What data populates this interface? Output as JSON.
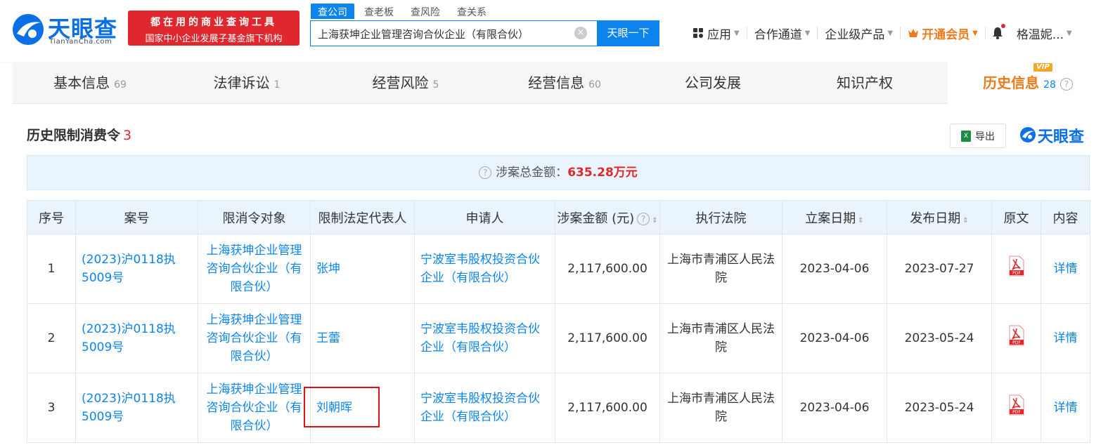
{
  "header": {
    "logo_text": "天眼查",
    "logo_sub": "TianYanCha.com",
    "slogan_line1": "都在用的商业查询工具",
    "slogan_line2": "国家中小企业发展子基金旗下机构",
    "search_tabs": [
      "查公司",
      "查老板",
      "查风险",
      "查关系"
    ],
    "search_value": "上海获坤企业管理咨询合伙企业（有限合伙）",
    "search_button": "天眼一下",
    "nav": {
      "apps": "应用",
      "partner": "合作通道",
      "enterprise": "企业级产品",
      "vip": "开通会员",
      "user": "格温妮..."
    }
  },
  "tabs": [
    {
      "label": "基本信息",
      "count": "69"
    },
    {
      "label": "法律诉讼",
      "count": "1"
    },
    {
      "label": "经营风险",
      "count": "5"
    },
    {
      "label": "经营信息",
      "count": "60"
    },
    {
      "label": "公司发展",
      "count": ""
    },
    {
      "label": "知识产权",
      "count": ""
    },
    {
      "label": "历史信息",
      "count": "28",
      "badge": "VIP"
    }
  ],
  "section": {
    "title": "历史限制消费令",
    "count": "3",
    "export_label": "导出",
    "watermark": "天眼查",
    "summary_label": "涉案总金额：",
    "summary_amount": "635.28万元"
  },
  "table": {
    "headers": [
      "序号",
      "案号",
      "限消令对象",
      "限制法定代表人",
      "申请人",
      "涉案金额 (元)",
      "执行法院",
      "立案日期",
      "发布日期",
      "原文",
      "内容"
    ],
    "rows": [
      {
        "no": "1",
        "case": "(2023)沪0118执5009号",
        "target": "上海获坤企业管理咨询合伙企业（有限合伙）",
        "person": "张坤",
        "applicant": "宁波室韦股权投资合伙企业（有限合伙）",
        "amount": "2,117,600.00",
        "court": "上海市青浦区人民法院",
        "filed": "2023-04-06",
        "published": "2023-07-27",
        "detail": "详情"
      },
      {
        "no": "2",
        "case": "(2023)沪0118执5009号",
        "target": "上海获坤企业管理咨询合伙企业（有限合伙）",
        "person": "王蕾",
        "applicant": "宁波室韦股权投资合伙企业（有限合伙）",
        "amount": "2,117,600.00",
        "court": "上海市青浦区人民法院",
        "filed": "2023-04-06",
        "published": "2023-05-24",
        "detail": "详情"
      },
      {
        "no": "3",
        "case": "(2023)沪0118执5009号",
        "target": "上海获坤企业管理咨询合伙企业（有限合伙）",
        "person": "刘朝晖",
        "applicant": "宁波室韦股权投资合伙企业（有限合伙）",
        "amount": "2,117,600.00",
        "court": "上海市青浦区人民法院",
        "filed": "2023-04-06",
        "published": "2023-05-24",
        "detail": "详情"
      }
    ]
  },
  "colors": {
    "accent": "#0b84ee",
    "brand": "#0b6fe5",
    "alert": "#e0272d",
    "vip": "#ee7a1a"
  }
}
